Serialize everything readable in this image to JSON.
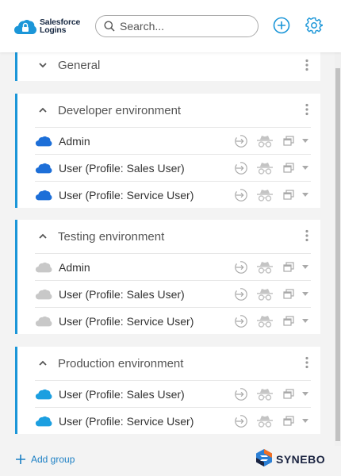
{
  "header": {
    "logo_line1": "Salesforce",
    "logo_line2": "Logins",
    "search_placeholder": "Search...",
    "icons": {
      "add": "plus-circle-icon",
      "settings": "gear-icon"
    }
  },
  "colors": {
    "accent": "#1b96d8",
    "cloud_blue": "#1d6fd8",
    "cloud_light_blue": "#1c9fe0",
    "cloud_gray": "#c8c8c8",
    "action_icon": "#bbbbbb"
  },
  "groups": [
    {
      "title": "General",
      "expanded": false,
      "users": []
    },
    {
      "title": "Developer environment",
      "expanded": true,
      "cloud": "blue",
      "users": [
        {
          "label": "Admin"
        },
        {
          "label": "User (Profile: Sales User)"
        },
        {
          "label": "User (Profile: Service User)"
        }
      ]
    },
    {
      "title": "Testing environment",
      "expanded": true,
      "cloud": "gray",
      "users": [
        {
          "label": "Admin"
        },
        {
          "label": "User (Profile: Sales User)"
        },
        {
          "label": "User (Profile: Service User)"
        }
      ]
    },
    {
      "title": "Production environment",
      "expanded": true,
      "cloud": "light-blue",
      "users": [
        {
          "label": "User (Profile: Sales User)"
        },
        {
          "label": "User (Profile: Service User)"
        }
      ]
    }
  ],
  "footer": {
    "add_group_label": "Add group",
    "brand": "SYNEBO"
  }
}
